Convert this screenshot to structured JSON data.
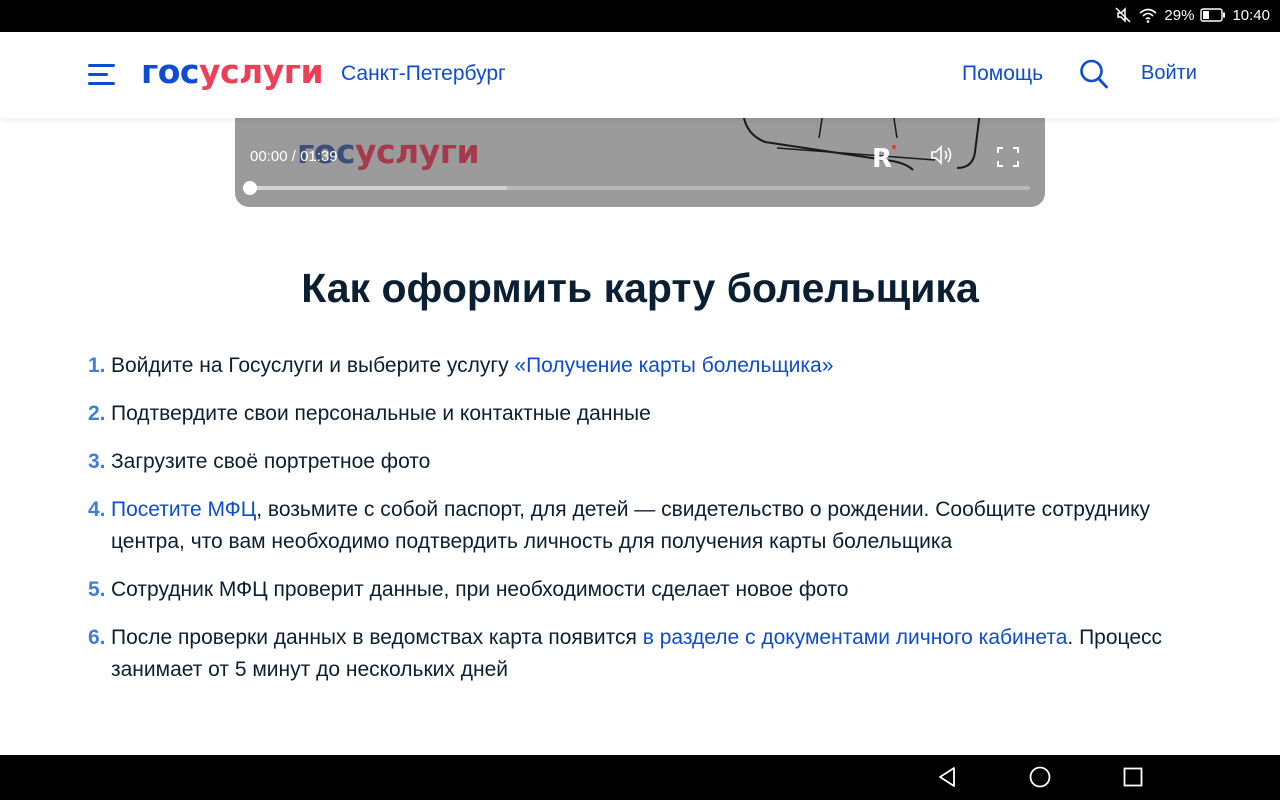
{
  "status_bar": {
    "battery": "29%",
    "time": "10:40",
    "icons": [
      "mute-icon",
      "wifi-icon",
      "battery-icon"
    ]
  },
  "header": {
    "logo": {
      "part1": "гос",
      "part2": "услуги"
    },
    "region": "Санкт-Петербург",
    "help": "Помощь",
    "login": "Войти",
    "icons": [
      "menu-icon",
      "search-icon"
    ]
  },
  "video": {
    "watermark": {
      "part1": "гос",
      "part2": "услуги"
    },
    "time_current": "00:00",
    "time_separator": " / ",
    "time_total": "01:39",
    "channel_logo": "R",
    "progress": 0,
    "buffered": 0.33,
    "icons": [
      "volume-icon",
      "fullscreen-icon"
    ]
  },
  "main": {
    "title": "Как оформить карту болельщика",
    "steps": [
      {
        "num": "1.",
        "text": "Войдите на Госуслуги и выберите услугу ",
        "link": "«Получение карты болельщика»"
      },
      {
        "num": "2.",
        "text": "Подтвердите свои персональные и контактные данные"
      },
      {
        "num": "3.",
        "text": "Загрузите своё портретное фото"
      },
      {
        "num": "4.",
        "link": "Посетите МФЦ",
        "text": ", возьмите с собой паспорт, для детей — свидетельство о рождении. Сообщите сотруднику центра, что вам необходимо подтвердить личность для получения карты болельщика"
      },
      {
        "num": "5.",
        "text": "Сотрудник МФЦ проверит данные, при необходимости сделает новое фото"
      },
      {
        "num": "6.",
        "text": "После проверки данных в ведомствах карта появится ",
        "link": "в разделе с документами личного кабинета",
        "text_after": ". Процесс занимает от 5 минут до нескольких дней"
      }
    ]
  },
  "nav_bar": {
    "icons": [
      "back-icon",
      "home-icon",
      "recents-icon"
    ]
  },
  "colors": {
    "brand_blue": "#0d4cd3",
    "brand_red": "#ee3f58",
    "step_number": "#3f7fd9",
    "text": "#0b1f33"
  }
}
